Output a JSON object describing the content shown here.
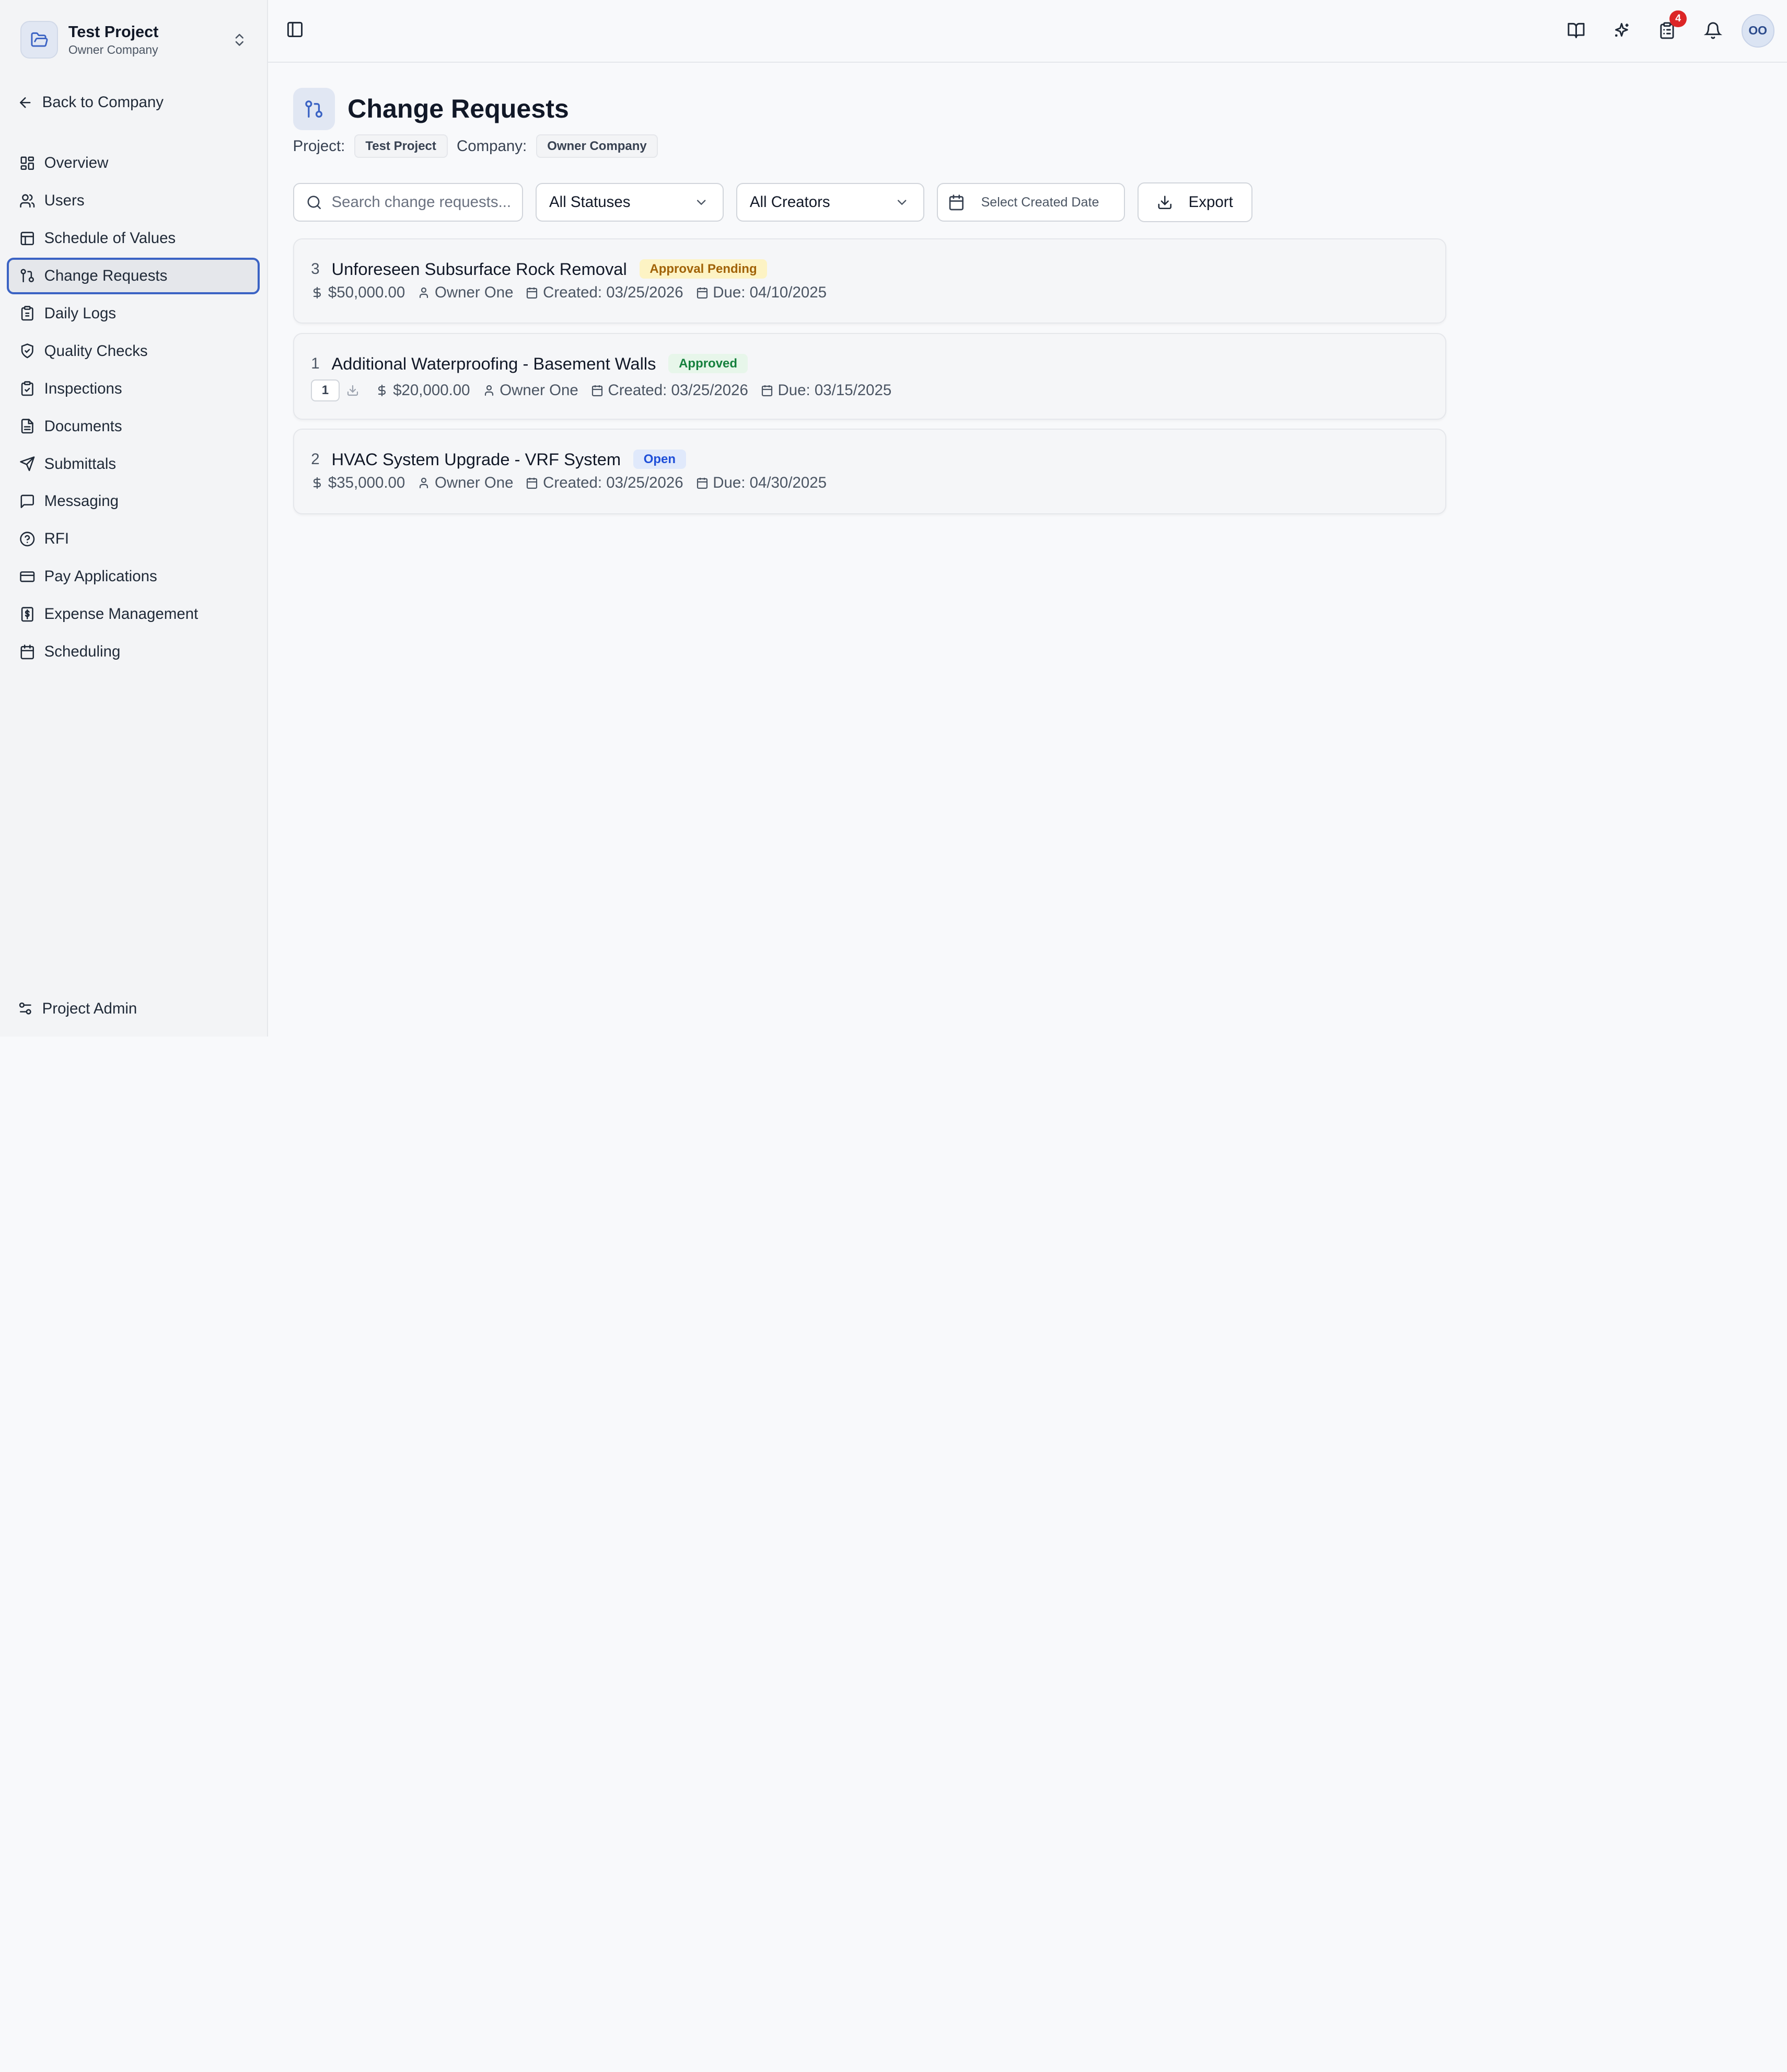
{
  "sidebar": {
    "project_name": "Test Project",
    "company_name": "Owner Company",
    "back_label": "Back to Company",
    "items": [
      {
        "label": "Overview",
        "icon": "layout-grid-icon"
      },
      {
        "label": "Users",
        "icon": "users-icon"
      },
      {
        "label": "Schedule of Values",
        "icon": "table-icon"
      },
      {
        "label": "Change Requests",
        "icon": "git-compare-icon",
        "active": true
      },
      {
        "label": "Daily Logs",
        "icon": "clipboard-icon"
      },
      {
        "label": "Quality Checks",
        "icon": "shield-check-icon"
      },
      {
        "label": "Inspections",
        "icon": "clipboard-check-icon"
      },
      {
        "label": "Documents",
        "icon": "file-icon"
      },
      {
        "label": "Submittals",
        "icon": "send-icon"
      },
      {
        "label": "Messaging",
        "icon": "message-icon"
      },
      {
        "label": "RFI",
        "icon": "help-circle-icon"
      },
      {
        "label": "Pay Applications",
        "icon": "credit-card-icon"
      },
      {
        "label": "Expense Management",
        "icon": "receipt-icon"
      },
      {
        "label": "Scheduling",
        "icon": "calendar-icon"
      }
    ],
    "admin_label": "Project Admin"
  },
  "topbar": {
    "tasks_badge": "4",
    "avatar_initials": "OO"
  },
  "page": {
    "title": "Change Requests",
    "project_label": "Project:",
    "project_value": "Test Project",
    "company_label": "Company:",
    "company_value": "Owner Company"
  },
  "filters": {
    "search_placeholder": "Search change requests...",
    "status_value": "All Statuses",
    "creator_value": "All Creators",
    "date_placeholder": "Select Created Date",
    "export_label": "Export"
  },
  "requests": [
    {
      "number": "3",
      "title": "Unforeseen Subsurface Rock Removal",
      "status": "Approval Pending",
      "amount": "$50,000.00",
      "creator": "Owner One",
      "created": "Created: 03/25/2026",
      "due": "Due: 04/10/2025"
    },
    {
      "number": "1",
      "title": "Additional Waterproofing - Basement Walls",
      "status": "Approved",
      "attachments": "1",
      "amount": "$20,000.00",
      "creator": "Owner One",
      "created": "Created: 03/25/2026",
      "due": "Due: 03/15/2025"
    },
    {
      "number": "2",
      "title": "HVAC System Upgrade - VRF System",
      "status": "Open",
      "amount": "$35,000.00",
      "creator": "Owner One",
      "created": "Created: 03/25/2026",
      "due": "Due: 04/30/2025"
    }
  ],
  "colors": {
    "accent": "#3b63c4",
    "pending_bg": "#fdf3c4",
    "approved_bg": "#e7f6ea",
    "open_bg": "#e0e9fb",
    "badge_red": "#dc2626"
  }
}
